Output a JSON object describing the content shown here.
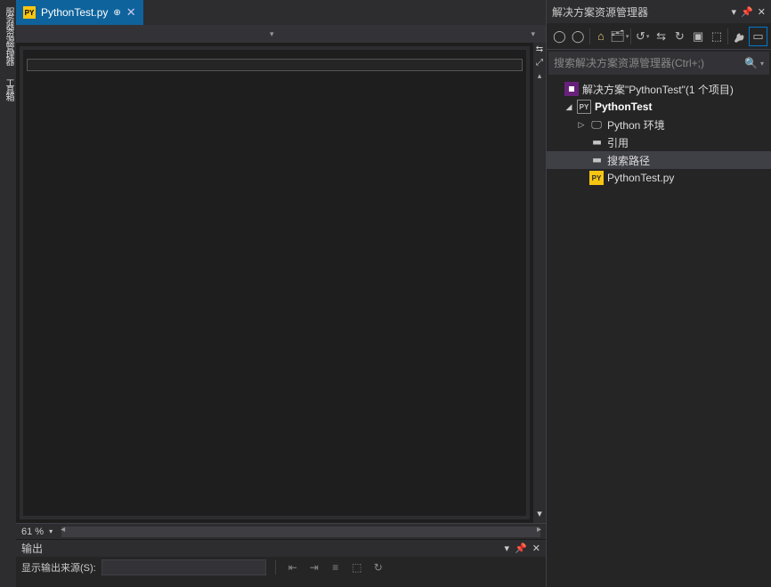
{
  "leftRail": {
    "tab1": "服务器资源管理器",
    "tab2": "工具箱"
  },
  "tab": {
    "label": "PythonTest.py",
    "iconText": "PY"
  },
  "editor": {
    "zoom": "61 %"
  },
  "output": {
    "title": "输出",
    "sourceLabel": "显示输出来源(S):"
  },
  "solutionExplorer": {
    "title": "解决方案资源管理器",
    "searchPlaceholder": "搜索解决方案资源管理器(Ctrl+;)",
    "tree": {
      "solution": "解决方案\"PythonTest\"(1 个项目)",
      "project": "PythonTest",
      "env": "Python 环境",
      "refs": "引用",
      "searchPaths": "搜索路径",
      "file": "PythonTest.py",
      "projIcon": "PY",
      "pyIcon": "PY"
    }
  }
}
